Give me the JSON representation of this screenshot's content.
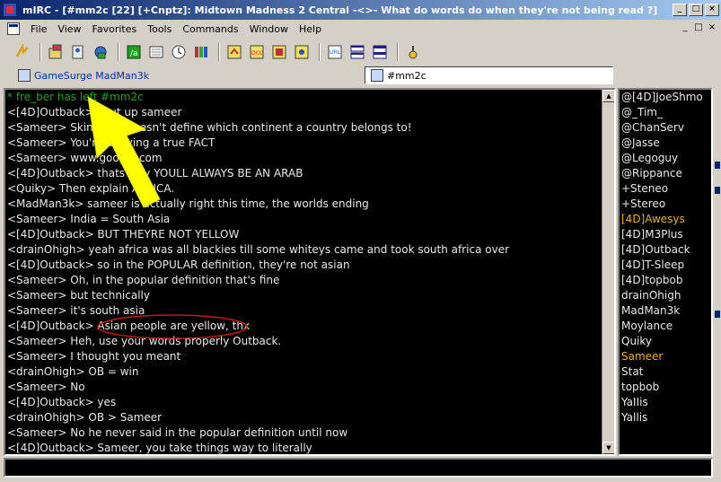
{
  "window": {
    "title": "mIRC - [#mm2c [22] [+Cnptz]: Midtown Madness 2 Central -<>- What do words do when they're not being read ?]",
    "buttons": [
      "_",
      "□",
      "×"
    ]
  },
  "menubar": {
    "items": [
      "File",
      "View",
      "Favorites",
      "Tools",
      "Commands",
      "Window",
      "Help"
    ],
    "mdi_buttons": [
      "_",
      "□",
      "×"
    ]
  },
  "toolbar": {
    "icons": [
      "connect-icon",
      "options-icon",
      "address-book-icon",
      "channels-folder-icon",
      "dcc-send-icon",
      "timer-icon",
      "colors-icon",
      "scripts-icon",
      "dcc-chat-icon",
      "log-icon",
      "notify-icon",
      "urls-icon",
      "tile-icon",
      "cascade-icon",
      "help-icon"
    ]
  },
  "switchbar": {
    "server_tab": "GameSurge MadMan3k",
    "channel_tab": "#mm2c"
  },
  "chat": {
    "lines": [
      {
        "text": "* fre_ber has left #mm2c",
        "kind": "part"
      },
      {
        "text": "<[4D]Outback> shut up sameer",
        "kind": "msg"
      },
      {
        "text": "<Sameer> Skin color doesn't define which continent a country belongs to!",
        "kind": "msg"
      },
      {
        "text": "<Sameer> You're denying a true FACT",
        "kind": "msg"
      },
      {
        "text": "<Sameer> www.google.com",
        "kind": "msg"
      },
      {
        "text": "<[4D]Outback> thats why YOULL ALWAYS BE AN ARAB",
        "kind": "msg"
      },
      {
        "text": "<Quiky> Then explain AFRICA.",
        "kind": "msg"
      },
      {
        "text": "<MadMan3k> sameer is actually right this time, the worlds ending",
        "kind": "msg"
      },
      {
        "text": "<Sameer> India = South Asia",
        "kind": "msg"
      },
      {
        "text": "<[4D]Outback> BUT THEYRE NOT YELLOW",
        "kind": "msg"
      },
      {
        "text": "<drainOhigh> yeah africa was all blackies till some whiteys came and took south africa over",
        "kind": "msg"
      },
      {
        "text": "<[4D]Outback> so in the POPULAR definition, they're not asian",
        "kind": "msg"
      },
      {
        "text": "<Sameer> Oh, in the popular definition that's fine",
        "kind": "msg"
      },
      {
        "text": "<Sameer> but technically",
        "kind": "msg"
      },
      {
        "text": "<Sameer> it's south asia",
        "kind": "msg"
      },
      {
        "text": "<[4D]Outback> Asian people are yellow, thx",
        "kind": "msg"
      },
      {
        "text": "<Sameer> Heh, use your words properly Outback.",
        "kind": "msg"
      },
      {
        "text": "<Sameer> I thought you meant",
        "kind": "msg"
      },
      {
        "text": "<drainOhigh> OB = win",
        "kind": "msg"
      },
      {
        "text": "<Sameer> No",
        "kind": "msg"
      },
      {
        "text": "<[4D]Outback> yes",
        "kind": "msg"
      },
      {
        "text": "<drainOhigh> OB > Sameer",
        "kind": "msg"
      },
      {
        "text": "<Sameer> No he never said in the popular definition until now",
        "kind": "msg"
      },
      {
        "text": "<[4D]Outback> Sameer, you take things way to literally",
        "kind": "msg"
      }
    ]
  },
  "nicklist": {
    "nicks": [
      {
        "name": "@[4D]JoeShmo",
        "hl": false
      },
      {
        "name": "@_Tim_",
        "hl": false
      },
      {
        "name": "@ChanServ",
        "hl": false
      },
      {
        "name": "@Jasse",
        "hl": false
      },
      {
        "name": "@Legoguy",
        "hl": false
      },
      {
        "name": "@Rippance",
        "hl": false
      },
      {
        "name": "+Steneo",
        "hl": false
      },
      {
        "name": "+Stereo",
        "hl": false
      },
      {
        "name": "[4D]Awesys",
        "hl": true
      },
      {
        "name": "[4D]M3Plus",
        "hl": false
      },
      {
        "name": "[4D]Outback",
        "hl": false
      },
      {
        "name": "[4D]T-Sleep",
        "hl": false
      },
      {
        "name": "[4D]topbob",
        "hl": false
      },
      {
        "name": "drainOhigh",
        "hl": false
      },
      {
        "name": "MadMan3k",
        "hl": false
      },
      {
        "name": "Moylance",
        "hl": false
      },
      {
        "name": "Quiky",
        "hl": false
      },
      {
        "name": "Sameer",
        "hl": true
      },
      {
        "name": "Stat",
        "hl": false
      },
      {
        "name": "topbob",
        "hl": false
      },
      {
        "name": "YaIIis",
        "hl": false
      },
      {
        "name": "Yallis",
        "hl": false
      }
    ]
  },
  "input": {
    "value": ""
  },
  "colors": {
    "part_message": "#1fa01f",
    "highlight_nick": "#e8b020",
    "arrow": "#ffff00",
    "circle": "#c81818"
  }
}
